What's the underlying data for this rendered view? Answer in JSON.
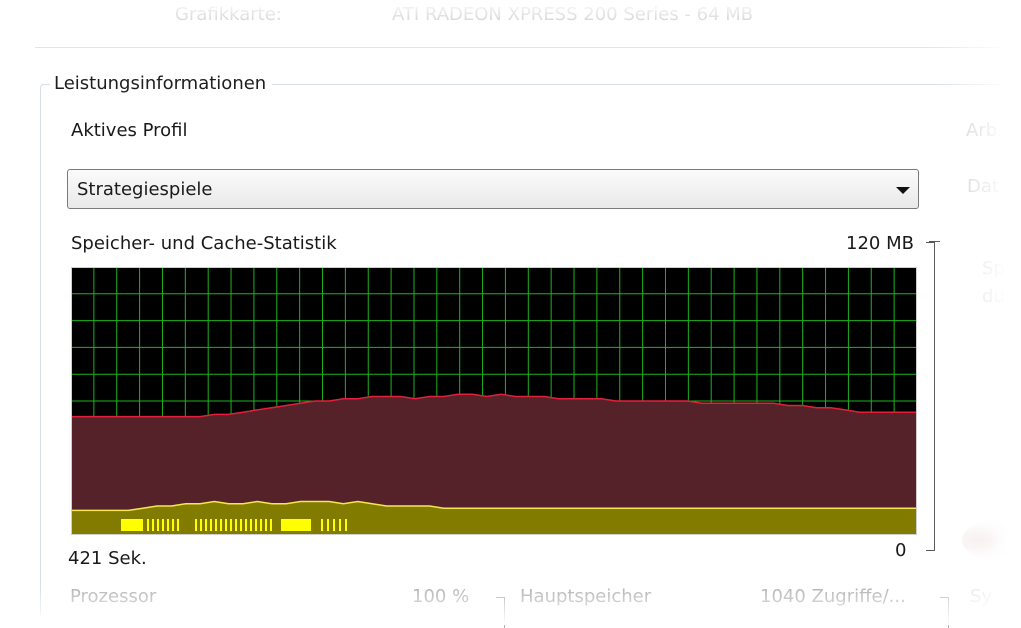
{
  "top": {
    "label": "Grafikkarte:",
    "value": "ATI RADEON XPRESS 200 Series - 64 MB"
  },
  "group_title": "Leistungsinformationen",
  "profile": {
    "label": "Aktives Profil",
    "selected": "Strategiespiele"
  },
  "right_column": [
    "Arb",
    "Dat",
    "Sp",
    "du"
  ],
  "chart_data": {
    "type": "area",
    "title": "Speicher- und Cache-Statistik",
    "y_max_label": "120 MB",
    "y_min_label": "0",
    "x_left_label": "421 Sek.",
    "ylim": [
      0,
      120
    ],
    "grid": true,
    "colors": {
      "background": "#000000",
      "grid": "#1db31d",
      "memory_fill": "#542228",
      "memory_line": "#e1203a",
      "cache_fill": "#817b00",
      "cache_line": "#f5e84a",
      "activity": "#ffff00"
    },
    "series": [
      {
        "values": [
          53,
          53,
          53,
          53,
          53,
          53,
          53,
          53,
          53,
          53,
          54,
          54,
          55,
          56,
          57,
          58,
          59,
          60,
          60,
          61,
          61,
          62,
          62,
          62,
          61,
          62,
          62,
          63,
          63,
          62,
          63,
          62,
          62,
          62,
          61,
          61,
          61,
          61,
          60,
          60,
          60,
          60,
          60,
          60,
          59,
          59,
          59,
          59,
          59,
          59,
          58,
          58,
          57,
          57,
          56,
          55,
          55,
          55,
          55,
          55
        ]
      },
      {
        "values": [
          11,
          11,
          11,
          11,
          11,
          12,
          13,
          13,
          14,
          14,
          15,
          14,
          14,
          15,
          14,
          14,
          15,
          15,
          15,
          14,
          15,
          14,
          13,
          13,
          13,
          13,
          12,
          12,
          12,
          12,
          12,
          12,
          12,
          12,
          12,
          12,
          12,
          12,
          12,
          12,
          12,
          12,
          12,
          12,
          12,
          12,
          12,
          12,
          12,
          12,
          12,
          12,
          12,
          12,
          12,
          12,
          12,
          12,
          12,
          12
        ]
      }
    ]
  },
  "bottom": {
    "cpu_label": "Prozessor",
    "cpu_value": "100 %",
    "mem_label": "Hauptspeicher",
    "mem_value": "1040 Zugriffe/...",
    "extra": "Sy"
  }
}
